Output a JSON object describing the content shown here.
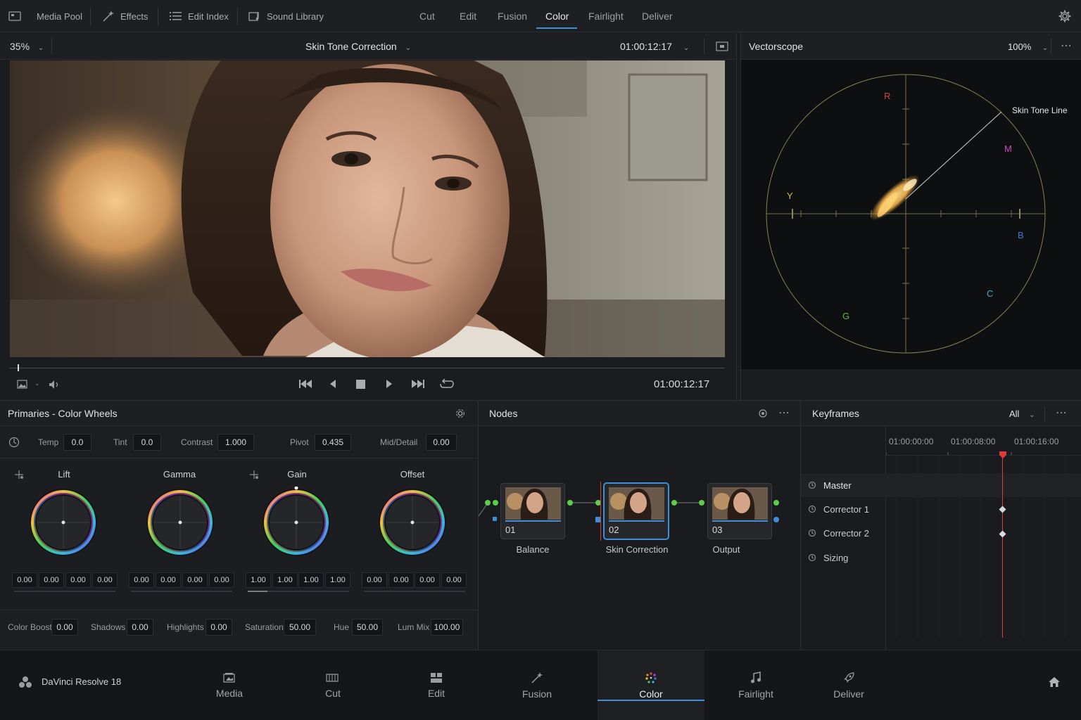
{
  "topbar": {
    "media_pool": "Media Pool",
    "effects": "Effects",
    "edit_index": "Edit Index",
    "sound_library": "Sound Library",
    "pages": [
      "Cut",
      "Edit",
      "Fusion",
      "Color",
      "Fairlight",
      "Deliver"
    ],
    "active_page": "Color"
  },
  "viewer": {
    "zoom": "35%",
    "clip_name": "Skin Tone Correction",
    "timecode_top": "01:00:12:17",
    "timecode_bottom": "01:00:12:17"
  },
  "vectorscope": {
    "title": "Vectorscope",
    "zoom": "100%",
    "skin_tone_label": "Skin Tone Line",
    "targets": {
      "r": "R",
      "m": "M",
      "b": "B",
      "c": "C",
      "g": "G",
      "y": "Y"
    }
  },
  "primaries": {
    "title": "Primaries - Color Wheels",
    "params": {
      "temp_label": "Temp",
      "temp_value": "0.0",
      "tint_label": "Tint",
      "tint_value": "0.0",
      "contrast_label": "Contrast",
      "contrast_value": "1.000",
      "pivot_label": "Pivot",
      "pivot_value": "0.435",
      "middetail_label": "Mid/Detail",
      "middetail_value": "0.00"
    },
    "wheels": [
      {
        "name": "Lift",
        "values": [
          "0.00",
          "0.00",
          "0.00",
          "0.00"
        ]
      },
      {
        "name": "Gamma",
        "values": [
          "0.00",
          "0.00",
          "0.00",
          "0.00"
        ]
      },
      {
        "name": "Gain",
        "values": [
          "1.00",
          "1.00",
          "1.00",
          "1.00"
        ]
      },
      {
        "name": "Offset",
        "values": [
          "0.00",
          "0.00",
          "0.00",
          "0.00"
        ]
      }
    ],
    "footer": {
      "color_boost_label": "Color Boost",
      "color_boost_value": "0.00",
      "shadows_label": "Shadows",
      "shadows_value": "0.00",
      "highlights_label": "Highlights",
      "highlights_value": "0.00",
      "saturation_label": "Saturation",
      "saturation_value": "50.00",
      "hue_label": "Hue",
      "hue_value": "50.00",
      "lummix_label": "Lum Mix",
      "lummix_value": "100.00"
    }
  },
  "nodes": {
    "title": "Nodes",
    "items": [
      {
        "num": "01",
        "label": "Balance"
      },
      {
        "num": "02",
        "label": "Skin Correction"
      },
      {
        "num": "03",
        "label": "Output"
      }
    ],
    "selected": "02"
  },
  "keyframes": {
    "title": "Keyframes",
    "filter": "All",
    "times": [
      "01:00:00:00",
      "01:00:08:00",
      "01:00:16:00"
    ],
    "tracks": [
      "Master",
      "Corrector 1",
      "Corrector 2",
      "Sizing"
    ]
  },
  "bottombar": {
    "app_name": "DaVinci Resolve 18",
    "tabs": [
      "Media",
      "Cut",
      "Edit",
      "Fusion",
      "Color",
      "Fairlight",
      "Deliver"
    ],
    "active_tab": "Color"
  },
  "colors": {
    "accent": "#3e8fd8",
    "playhead": "#e03a3a",
    "scope_trace": "#e8b04a",
    "connector_green": "#5ccf4a"
  }
}
